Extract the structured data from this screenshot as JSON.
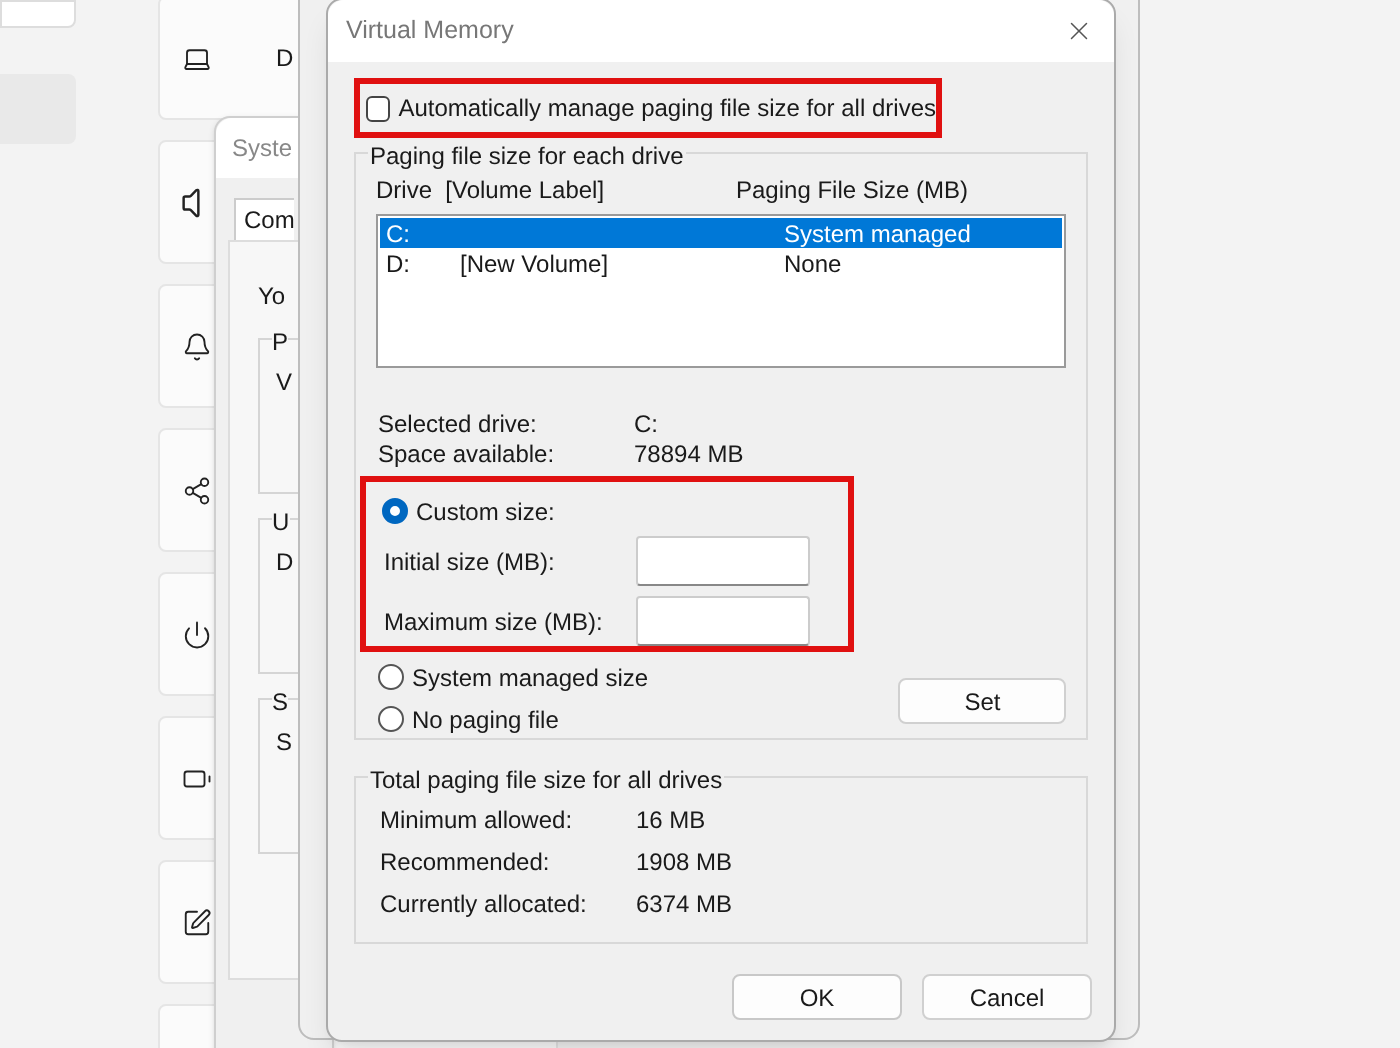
{
  "settings_cards": [
    {
      "kind": "laptop",
      "text": "D"
    },
    {
      "kind": "speaker"
    },
    {
      "kind": "bell"
    },
    {
      "kind": "share"
    },
    {
      "kind": "power"
    },
    {
      "kind": "battery"
    },
    {
      "kind": "pen"
    },
    {
      "kind": "blank"
    }
  ],
  "system_properties": {
    "title": "Syste",
    "tab": "Com",
    "intro": "Yo",
    "groups": [
      {
        "label": "P",
        "text": "V"
      },
      {
        "label": "U",
        "text": "D"
      },
      {
        "label": "S",
        "text": "S"
      }
    ]
  },
  "dialog": {
    "title": "Virtual Memory",
    "auto_manage": {
      "label": "Automatically manage paging file size for all drives",
      "checked": false
    },
    "per_drive_group": {
      "title": "Paging file size for each drive",
      "columns": [
        "Drive  [Volume Label]",
        "Paging File Size (MB)"
      ],
      "drives": [
        {
          "drive": "C:",
          "size": "System managed",
          "selected": true
        },
        {
          "drive": "D:",
          "label": "[New Volume]",
          "size": "None",
          "selected": false
        }
      ],
      "info": [
        {
          "label": "Selected drive:",
          "value": "C:"
        },
        {
          "label": "Space available:",
          "value": "78894 MB"
        }
      ],
      "options": [
        {
          "label": "Custom size:",
          "selected": true
        },
        {
          "label": "System managed size",
          "selected": false
        },
        {
          "label": "No paging file",
          "selected": false
        }
      ],
      "fields": [
        {
          "label": "Initial size (MB):"
        },
        {
          "label": "Maximum size (MB):"
        }
      ],
      "set_button": "Set"
    },
    "totals_group": {
      "title": "Total paging file size for all drives",
      "rows": [
        {
          "label": "Minimum allowed:",
          "value": "16 MB"
        },
        {
          "label": "Recommended:",
          "value": "1908 MB"
        },
        {
          "label": "Currently allocated:",
          "value": "6374 MB"
        }
      ]
    },
    "buttons": [
      "OK",
      "Cancel"
    ]
  }
}
